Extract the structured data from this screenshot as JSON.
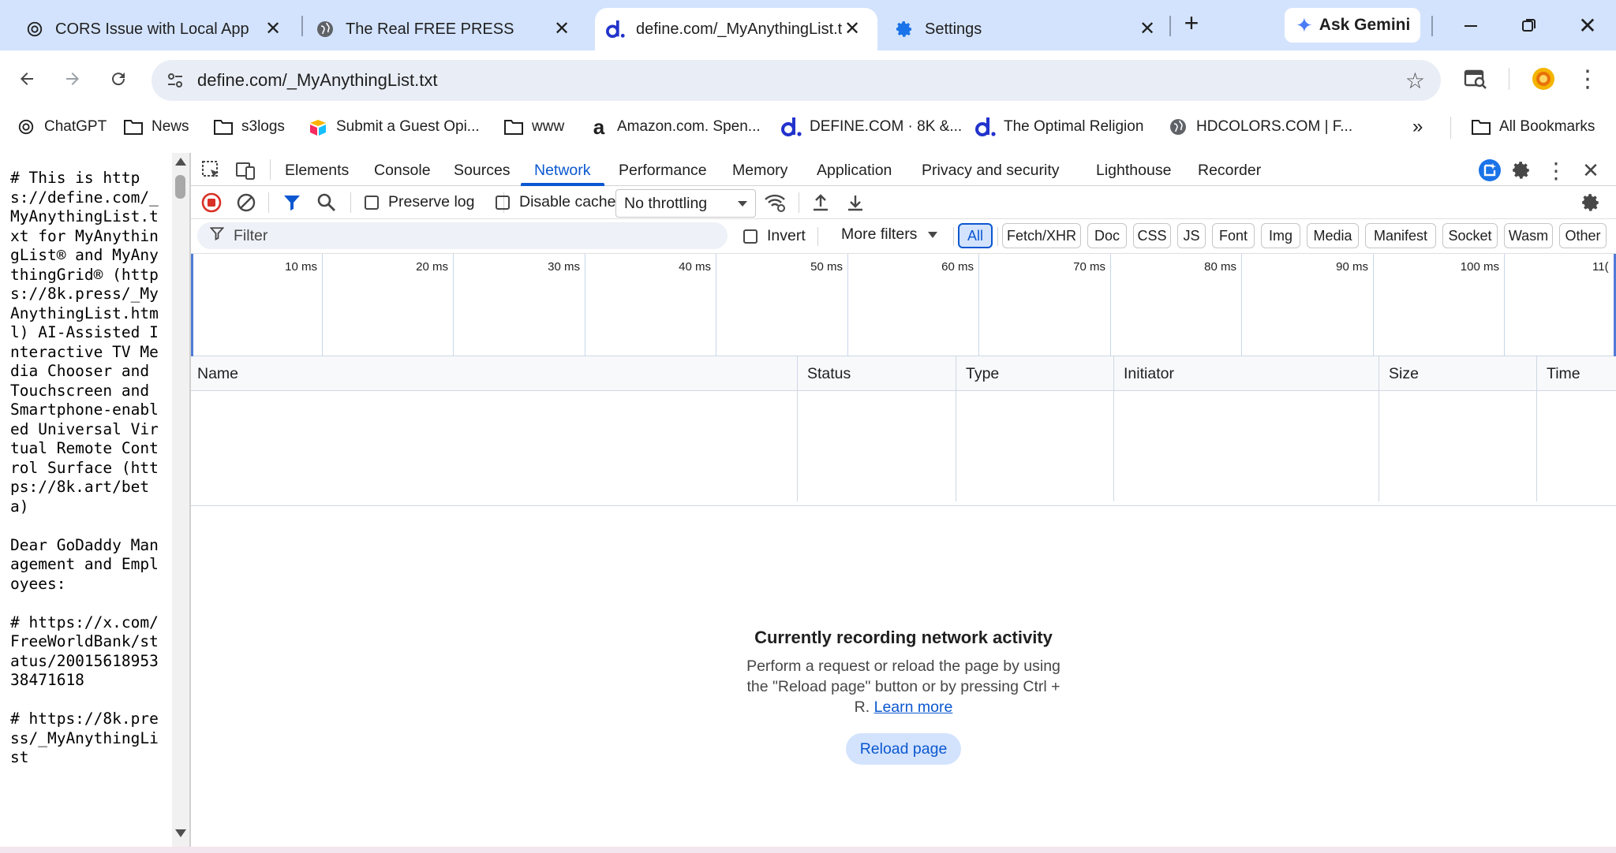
{
  "tabs": [
    {
      "title": "CORS Issue with Local App",
      "icon": "chatgpt-icon"
    },
    {
      "title": "The Real FREE PRESS",
      "icon": "globe-icon"
    },
    {
      "title": "define.com/_MyAnythingList.t",
      "icon": "define-d-icon",
      "active": true
    },
    {
      "title": "Settings",
      "icon": "gear-icon"
    }
  ],
  "gemini_label": "Ask Gemini",
  "address": {
    "url": "define.com/_MyAnythingList.txt"
  },
  "bookmarks": [
    {
      "label": "ChatGPT",
      "icon": "chatgpt-icon"
    },
    {
      "label": "News",
      "icon": "folder-icon"
    },
    {
      "label": "s3logs",
      "icon": "folder-icon"
    },
    {
      "label": "Submit a Guest Opi...",
      "icon": "airtable-icon"
    },
    {
      "label": "www",
      "icon": "folder-icon"
    },
    {
      "label": "Amazon.com. Spen...",
      "icon": "amazon-icon"
    },
    {
      "label": "DEFINE.COM · 8K &...",
      "icon": "define-d-icon"
    },
    {
      "label": "The Optimal Religion",
      "icon": "define-d-icon"
    },
    {
      "label": "HDCOLORS.COM | F...",
      "icon": "globe-icon"
    }
  ],
  "all_bookmarks_label": "All Bookmarks",
  "page_text": "# This is https://define.com/_MyAnythingList.txt for MyAnythingList® and MyAnythingGrid® (https://8k.press/_MyAnythingList.html) AI-Assisted Interactive TV Media Chooser and Touchscreen and Smartphone-enabled Universal Virtual Remote Control Surface (https://8k.art/beta)\n\nDear GoDaddy Management and Employees:\n\n# https://x.com/FreeWorldBank/status/2001561895338471618\n\n# https://8k.press/_MyAnythingList",
  "devtools": {
    "tabs": [
      "Elements",
      "Console",
      "Sources",
      "Network",
      "Performance",
      "Memory",
      "Application",
      "Privacy and security",
      "Lighthouse",
      "Recorder"
    ],
    "active_tab": "Network",
    "preserve_log": "Preserve log",
    "disable_cache": "Disable cache",
    "throttling": "No throttling",
    "filter_placeholder": "Filter",
    "invert": "Invert",
    "more_filters": "More filters",
    "type_filters": [
      "All",
      "Fetch/XHR",
      "Doc",
      "CSS",
      "JS",
      "Font",
      "Img",
      "Media",
      "Manifest",
      "Socket",
      "Wasm",
      "Other"
    ],
    "timeline_ticks": [
      "10 ms",
      "20 ms",
      "30 ms",
      "40 ms",
      "50 ms",
      "60 ms",
      "70 ms",
      "80 ms",
      "90 ms",
      "100 ms",
      "11("
    ],
    "columns": [
      "Name",
      "Status",
      "Type",
      "Initiator",
      "Size",
      "Time"
    ],
    "empty_title": "Currently recording network activity",
    "empty_desc": "Perform a request or reload the page by using the \"Reload page\" button or by pressing Ctrl + R.",
    "learn_more": "Learn more",
    "reload_button": "Reload page"
  },
  "colors": {
    "accent": "#0b57d0",
    "tabstrip": "#d3e3fd",
    "record": "#d93025"
  }
}
